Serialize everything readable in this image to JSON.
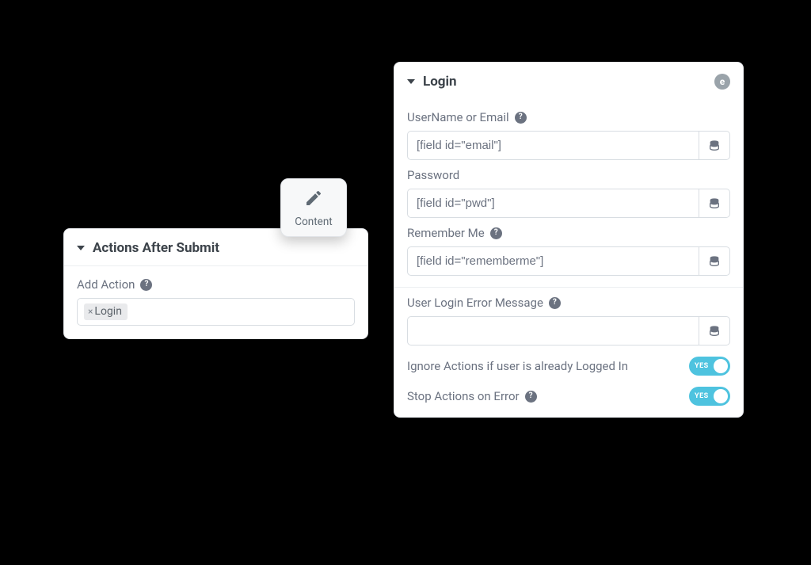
{
  "actionsPanel": {
    "title": "Actions After Submit",
    "addActionLabel": "Add Action",
    "chips": [
      "Login"
    ]
  },
  "contentCard": {
    "label": "Content"
  },
  "loginPanel": {
    "title": "Login",
    "logoLetter": "e",
    "fields": {
      "username": {
        "label": "UserName or Email",
        "value": "[field id=\"email\"]",
        "help": true
      },
      "password": {
        "label": "Password",
        "value": "[field id=\"pwd\"]",
        "help": false
      },
      "rememberMe": {
        "label": "Remember Me",
        "value": "[field id=\"rememberme\"]",
        "help": true
      },
      "errorMessage": {
        "label": "User Login Error Message",
        "value": "",
        "help": true
      }
    },
    "toggles": {
      "ignoreLoggedIn": {
        "label": "Ignore Actions if user is already Logged In",
        "help": false,
        "state": "YES"
      },
      "stopOnError": {
        "label": "Stop Actions on Error",
        "help": true,
        "state": "YES"
      }
    }
  }
}
